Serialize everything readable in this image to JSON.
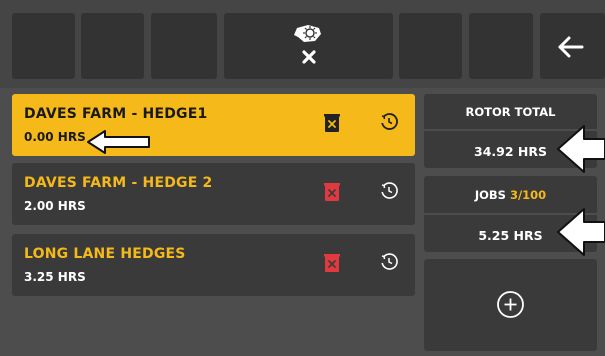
{
  "jobs": [
    {
      "name": "DAVES FARM - HEDGE1",
      "hours": "0.00 HRS",
      "selected": true
    },
    {
      "name": "DAVES FARM - HEDGE 2",
      "hours": "2.00 HRS",
      "selected": false
    },
    {
      "name": "LONG LANE HEDGES",
      "hours": "3.25 HRS",
      "selected": false
    }
  ],
  "rotor_total": {
    "label": "ROTOR TOTAL",
    "value": "34.92 HRS"
  },
  "jobs_panel": {
    "label": "JOBS",
    "count": "3/100",
    "value": "5.25 HRS"
  },
  "icons": {
    "top_center": "rotor-cancel-icon",
    "top_right": "back-arrow-icon",
    "job_delete": "delete-icon",
    "job_reset": "reset-icon",
    "add": "add-circle-icon"
  },
  "colors": {
    "accent": "#f6b91a",
    "delete_red": "#e03a3e",
    "panel": "#3a3a3a",
    "background": "#4d4d4d"
  }
}
